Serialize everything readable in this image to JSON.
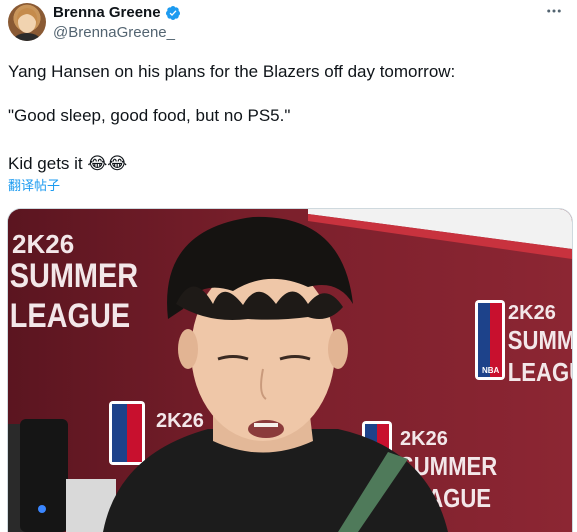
{
  "author": {
    "name": "Brenna Greene",
    "handle": "@BrennaGreene_",
    "verified": true
  },
  "more_icon": "more-horizontal-icon",
  "tweet": {
    "line1": "Yang Hansen on his plans for the Blazers off day tomorrow:",
    "line2": "\"Good sleep, good food, but no PS5.\"",
    "line3": "Kid gets it 😂😂",
    "translate_label": "翻译帖子"
  },
  "media": {
    "backdrop_logo_top": "2K26",
    "backdrop_logo_mid": "SUMMER",
    "backdrop_logo_bottom": "LEAGUE",
    "nba_badge": "NBA"
  },
  "colors": {
    "accent_blue": "#1d9bf0",
    "secondary_text": "#536471",
    "backdrop_red": "#7a1f2b"
  }
}
